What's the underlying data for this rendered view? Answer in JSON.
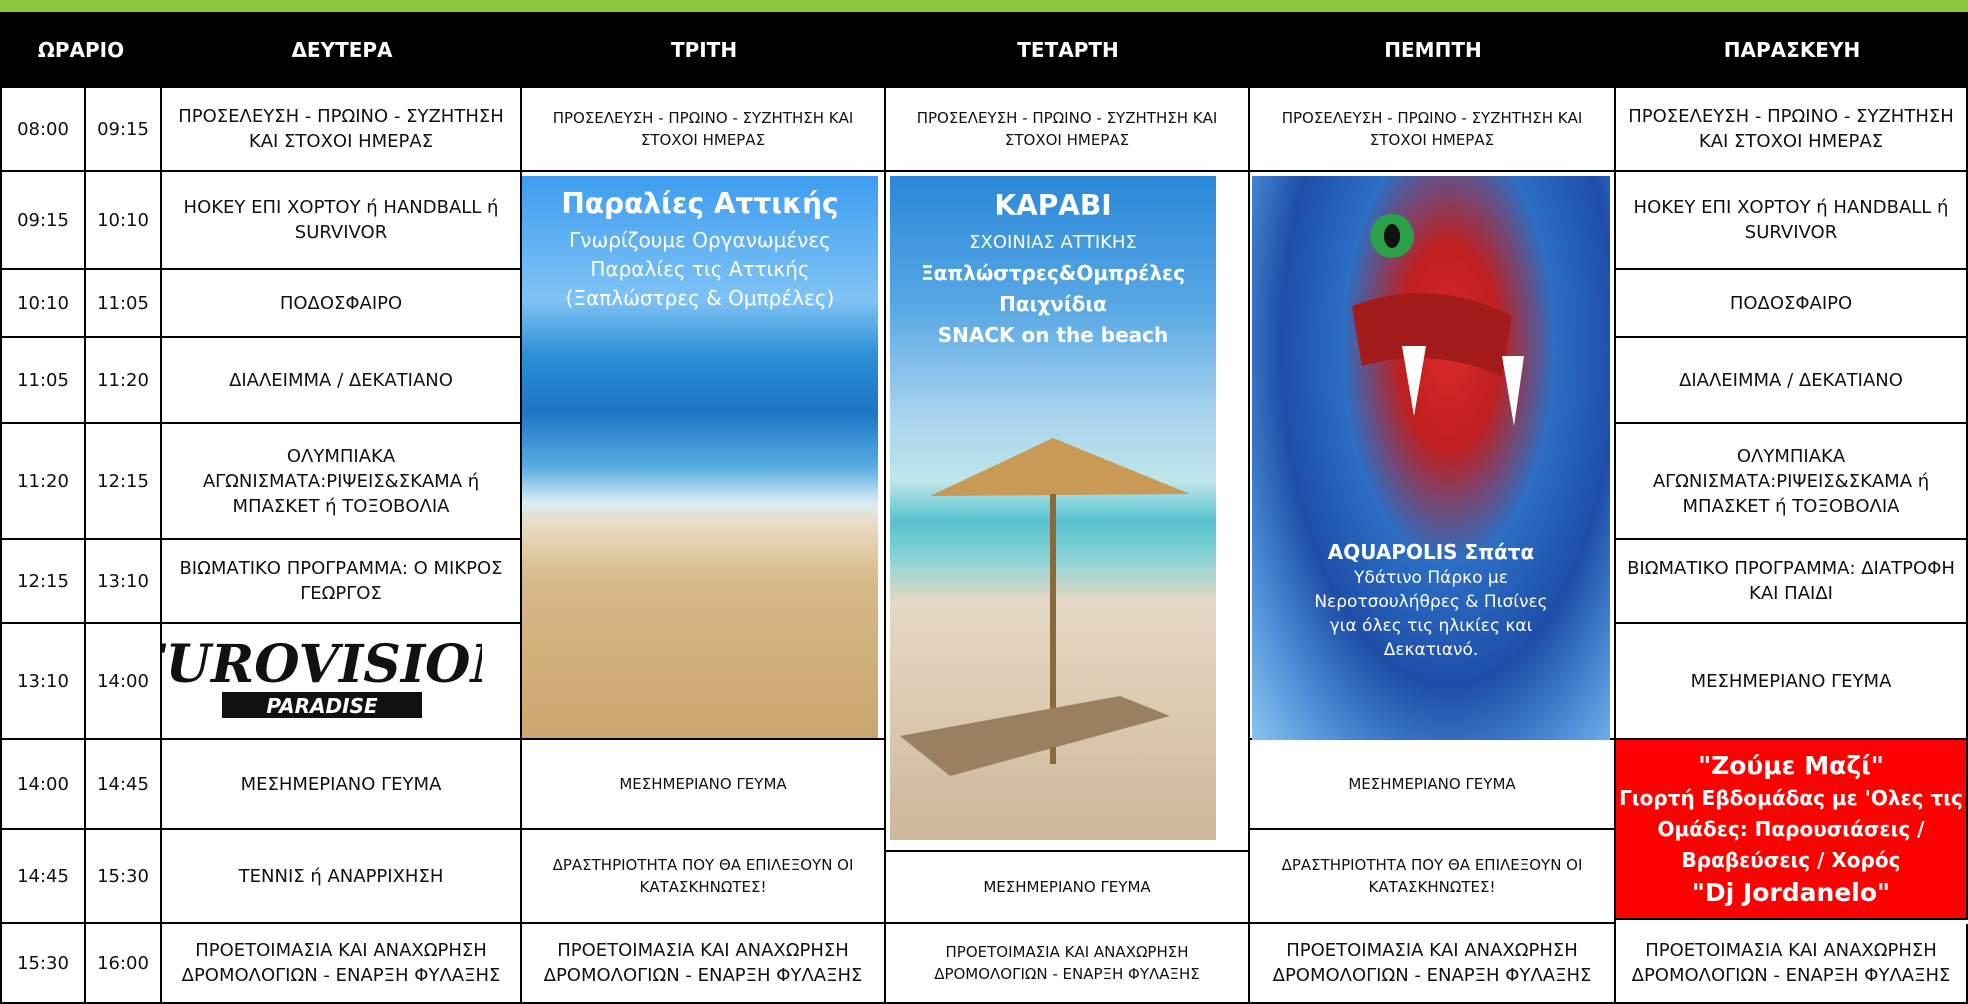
{
  "header": {
    "time": "ΩΡΑΡΙΟ",
    "days": [
      "ΔΕΥΤΕΡΑ",
      "ΤΡΙΤΗ",
      "ΤΕΤΑΡΤΗ",
      "ΠΕΜΠΤΗ",
      "ΠΑΡΑΣΚΕΥΗ"
    ]
  },
  "times": [
    [
      "08:00",
      "09:15"
    ],
    [
      "09:15",
      "10:10"
    ],
    [
      "10:10",
      "11:05"
    ],
    [
      "11:05",
      "11:20"
    ],
    [
      "11:20",
      "12:15"
    ],
    [
      "12:15",
      "13:10"
    ],
    [
      "13:10",
      "14:00"
    ],
    [
      "14:00",
      "14:45"
    ],
    [
      "14:45",
      "15:30"
    ],
    [
      "15:30",
      "16:00"
    ]
  ],
  "monday": [
    "ΠΡΟΣΕΛΕΥΣΗ - ΠΡΩΙΝΟ - ΣΥΖΗΤΗΣΗ ΚΑΙ ΣΤΟΧΟΙ ΗΜΕΡΑΣ",
    "ΗΟΚΕΥ ΕΠΙ ΧΟΡΤΟΥ ή HANDBALL ή SURVIVOR",
    "ΠΟΔΟΣΦΑΙΡΟ",
    "ΔΙΑΛΕΙΜΜΑ / ΔΕΚΑΤΙΑΝΟ",
    "ΟΛΥΜΠΙΑΚΑ ΑΓΩΝΙΣΜΑΤΑ:ΡΙΨΕΙΣ&ΣΚΑΜΑ ή ΜΠΑΣΚΕΤ ή ΤΟΞΟΒΟΛΙΑ",
    "ΒΙΩΜΑΤΙΚΟ ΠΡΟΓΡΑΜΜΑ: Ο ΜΙΚΡΟΣ ΓΕΩΡΓΟΣ",
    "ΜΕΣΗΜΕΡΙΑΝΟ ΓΕΥΜΑ",
    "ΤΕΝΝΙΣ ή ΑΝΑΡΡΙΧΗΣΗ",
    "ΠΡΟΕΤΟΙΜΑΣΙΑ ΚΑΙ ΑΝΑΧΩΡΗΣΗ ΔΡΟΜΟΛΟΓΙΩΝ - ΕΝΑΡΞΗ ΦΥΛΑΞΗΣ"
  ],
  "eurovision": {
    "line1": "EUROVISION",
    "line2": "PARADISE"
  },
  "tuesday": {
    "arrival": "ΠΡΟΣΕΛΕΥΣΗ - ΠΡΩΙΝΟ - ΣΥΖΗΤΗΣΗ ΚΑΙ ΣΤΟΧΟΙ ΗΜΕΡΑΣ",
    "lunch": "ΜΕΣΗΜΕΡΙΑΝΟ ΓΕΥΜΑ",
    "activity": "ΔΡΑΣΤΗΡΙΟΤΗΤΑ ΠΟΥ ΘΑ ΕΠΙΛΕΞΟΥΝ ΟΙ ΚΑΤΑΣΚΗΝΩΤΕΣ!",
    "departure": "ΠΡΟΕΤΟΙΜΑΣΙΑ ΚΑΙ ΑΝΑΧΩΡΗΣΗ ΔΡΟΜΟΛΟΓΙΩΝ - ΕΝΑΡΞΗ ΦΥΛΑΞΗΣ",
    "excursion": {
      "title": "Παραλίες Αττικής",
      "text1": "Γνωρίζουμε Οργανωμένες",
      "text2": "Παραλίες τις Αττικής",
      "text3": "(Ξαπλώστρες & Ομπρέλες)"
    }
  },
  "wednesday": {
    "arrival": "ΠΡΟΣΕΛΕΥΣΗ - ΠΡΩΙΝΟ - ΣΥΖΗΤΗΣΗ ΚΑΙ ΣΤΟΧΟΙ ΗΜΕΡΑΣ",
    "lunch": "ΜΕΣΗΜΕΡΙΑΝΟ ΓΕΥΜΑ",
    "departure": "ΠΡΟΕΤΟΙΜΑΣΙΑ ΚΑΙ ΑΝΑΧΩΡΗΣΗ ΔΡΟΜΟΛΟΓΙΩΝ - ΕΝΑΡΞΗ ΦΥΛΑΞΗΣ",
    "excursion": {
      "title": "ΚΑΡΑΒΙ",
      "text1": "ΣΧΟΙΝΙΑΣ ΑΤΤΙΚΗΣ",
      "text2": "Ξαπλώστρες&Ομπρέλες",
      "text3": "Παιχνίδια",
      "text4": "SNACK on the beach"
    }
  },
  "thursday": {
    "arrival": "ΠΡΟΣΕΛΕΥΣΗ - ΠΡΩΙΝΟ - ΣΥΖΗΤΗΣΗ ΚΑΙ ΣΤΟΧΟΙ ΗΜΕΡΑΣ",
    "lunch": "ΜΕΣΗΜΕΡΙΑΝΟ ΓΕΥΜΑ",
    "activity": "ΔΡΑΣΤΗΡΙΟΤΗΤΑ ΠΟΥ ΘΑ ΕΠΙΛΕΞΟΥΝ ΟΙ ΚΑΤΑΣΚΗΝΩΤΕΣ!",
    "departure": "ΠΡΟΕΤΟΙΜΑΣΙΑ ΚΑΙ ΑΝΑΧΩΡΗΣΗ ΔΡΟΜΟΛΟΓΙΩΝ - ΕΝΑΡΞΗ ΦΥΛΑΞΗΣ",
    "excursion": {
      "title": "AQUAPOLIS Σπάτα",
      "text1": "Υδάτινο Πάρκο με",
      "text2": "Νεροτσουλήθρες & Πισίνες",
      "text3": "για όλες τις ηλικίες και",
      "text4": "Δεκατιανό."
    }
  },
  "friday": [
    "ΠΡΟΣΕΛΕΥΣΗ - ΠΡΩΙΝΟ - ΣΥΖΗΤΗΣΗ ΚΑΙ ΣΤΟΧΟΙ ΗΜΕΡΑΣ",
    "ΗΟΚΕΥ ΕΠΙ ΧΟΡΤΟΥ ή HANDBALL ή SURVIVOR",
    "ΠΟΔΟΣΦΑΙΡΟ",
    "ΔΙΑΛΕΙΜΜΑ / ΔΕΚΑΤΙΑΝΟ",
    "ΟΛΥΜΠΙΑΚΑ ΑΓΩΝΙΣΜΑΤΑ:ΡΙΨΕΙΣ&ΣΚΑΜΑ ή ΜΠΑΣΚΕΤ ή ΤΟΞΟΒΟΛΙΑ",
    "ΒΙΩΜΑΤΙΚΟ ΠΡΟΓΡΑΜΜΑ: ΔΙΑΤΡΟΦΗ ΚΑΙ ΠΑΙΔΙ",
    "ΜΕΣΗΜΕΡΙΑΝΟ ΓΕΥΜΑ",
    "ΠΡΟΕΤΟΙΜΑΣΙΑ ΚΑΙ ΑΝΑΧΩΡΗΣΗ ΔΡΟΜΟΛΟΓΙΩΝ - ΕΝΑΡΞΗ ΦΥΛΑΞΗΣ"
  ],
  "friday_event": {
    "title": "\"Ζούμε Μαζί\"",
    "line1": "Γιορτή Εβδομάδας με 'Ολες τις",
    "line2": "Ομάδες: Παρουσιάσεις /",
    "line3": "Βραβεύσεις / Χορός",
    "line4": "\"Dj Jordanelo\""
  },
  "colors": {
    "accent_green": "#8cc63f",
    "header_bg": "#000000",
    "event_red": "#ff0000",
    "excursion_title": "#ffffff"
  }
}
